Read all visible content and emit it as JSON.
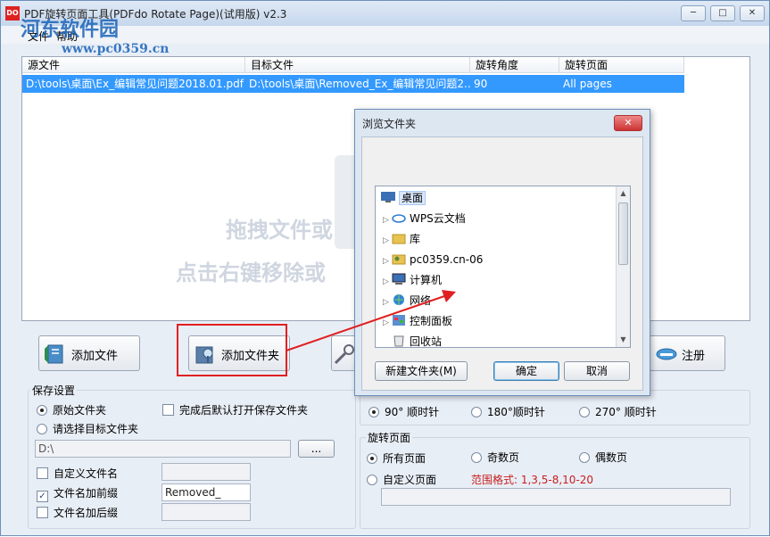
{
  "window": {
    "title": "PDF旋转页面工具(PDFdo Rotate Page)(试用版) v2.3",
    "icon_text": "DO",
    "min_label": "─",
    "max_label": "□",
    "close_label": "✕"
  },
  "watermark": {
    "name": "河东软件园",
    "url": "www.pc0359.cn"
  },
  "menu": [
    "文件",
    "帮助"
  ],
  "filelist": {
    "columns": [
      "源文件",
      "目标文件",
      "旋转角度",
      "旋转页面"
    ],
    "rows": [
      [
        "D:\\tools\\桌面\\Ex_编辑常见问题2018.01.pdf",
        "D:\\tools\\桌面\\Removed_Ex_编辑常见问题2...",
        "90",
        "All pages"
      ]
    ],
    "hint_line1": "拖拽文件或",
    "hint_line2": "点击右键移除或"
  },
  "buttons": {
    "add_file": "添加文件",
    "add_folder": "添加文件夹",
    "register": "注册"
  },
  "save_settings": {
    "title": "保存设置",
    "original_folder": "原始文件夹",
    "open_after": "完成后默认打开保存文件夹",
    "choose_target": "请选择目标文件夹",
    "path_value": "D:\\",
    "browse_label": "...",
    "custom_filename": "自定义文件名",
    "prefix_label": "文件名加前缀",
    "prefix_value": "Removed_",
    "suffix_label": "文件名加后缀"
  },
  "rotation": {
    "deg90": "90° 顺时针",
    "deg180": "180°顺时针",
    "deg270": "270° 顺时针"
  },
  "rotate_pages": {
    "title": "旋转页面",
    "all": "所有页面",
    "odd": "奇数页",
    "even": "偶数页",
    "custom": "自定义页面",
    "range_hint": "范围格式: 1,3,5-8,10-20"
  },
  "dialog": {
    "title": "浏览文件夹",
    "close_label": "✕",
    "tree": [
      {
        "label": "桌面",
        "icon": "desktop-icon",
        "selected": true
      },
      {
        "label": "WPS云文档",
        "icon": "cloud-icon"
      },
      {
        "label": "库",
        "icon": "library-folder-icon"
      },
      {
        "label": "pc0359.cn-06",
        "icon": "user-folder-icon"
      },
      {
        "label": "计算机",
        "icon": "computer-icon"
      },
      {
        "label": "网络",
        "icon": "network-icon"
      },
      {
        "label": "控制面板",
        "icon": "control-panel-icon"
      },
      {
        "label": "回收站",
        "icon": "recycle-bin-icon"
      }
    ],
    "new_folder": "新建文件夹(M)",
    "ok": "确定",
    "cancel": "取消"
  },
  "colors": {
    "selection": "#3399ff",
    "highlight_box": "#e02020",
    "range_hint": "#c81e1e"
  }
}
